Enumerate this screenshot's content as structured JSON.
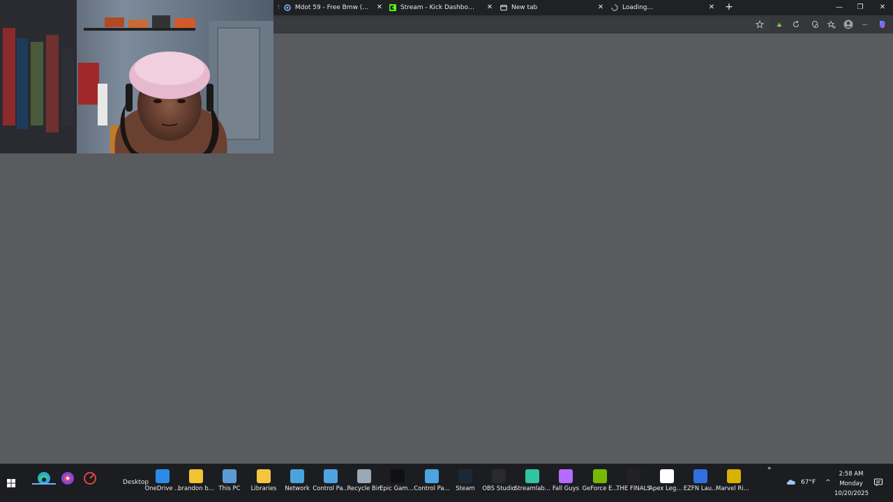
{
  "browser": {
    "tabs": [
      {
        "title": "Mdot 59 - Free Bmw (DirBy...",
        "favicon": "circle-icon"
      },
      {
        "title": "Stream - Kick Dashboard",
        "favicon": "kick-logo-icon"
      },
      {
        "title": "New tab",
        "favicon": "newtab-page-icon"
      },
      {
        "title": "Loading...",
        "favicon": "loading-spinner-icon"
      }
    ],
    "new_tab_symbol": "+",
    "close_symbol": "✕",
    "window_controls": {
      "minimize": "—",
      "restore": "❐",
      "close": "✕"
    },
    "toolbar_icons": [
      "star-icon",
      "extension-icon",
      "refresh-extension-icon",
      "browser-essentials-icon",
      "favorites-icon",
      "profile-avatar-icon",
      "more-menu-icon",
      "copilot-icon"
    ],
    "more_symbol": "···"
  },
  "taskbar": {
    "desktop_label": "Desktop",
    "pinned": [
      "edge-browser-icon",
      "app-icon-purple",
      "app-icon-red"
    ],
    "toolbar_items": [
      {
        "label": "OneDrive ...",
        "color": "#2b8be6"
      },
      {
        "label": "brandon b...",
        "color": "#f1c232"
      },
      {
        "label": "This PC",
        "color": "#5b9bd5"
      },
      {
        "label": "Libraries",
        "color": "#f4c542"
      },
      {
        "label": "Network",
        "color": "#4aa3df"
      },
      {
        "label": "Control Pa...",
        "color": "#4fa3e0"
      },
      {
        "label": "Recycle Bin",
        "color": "#9aa7b5"
      },
      {
        "label": "Epic Game...",
        "color": "#111111"
      },
      {
        "label": "Control Pa...",
        "color": "#4fa3e0"
      },
      {
        "label": "Steam",
        "color": "#1b2838"
      },
      {
        "label": "OBS Studio",
        "color": "#2a2a2a"
      },
      {
        "label": "Streamlab...",
        "color": "#31c3a2"
      },
      {
        "label": "Fall Guys",
        "color": "#b36cff"
      },
      {
        "label": "GeForce E...",
        "color": "#76b900"
      },
      {
        "label": "THE FINALS",
        "color": "#222222"
      },
      {
        "label": "Apex Lege...",
        "color": "#ffffff"
      },
      {
        "label": "EZFN Lau...",
        "color": "#2f6fe0"
      },
      {
        "label": "Marvel Riv...",
        "color": "#d8b200"
      }
    ],
    "overflow_symbol": "»",
    "weather": "67°F",
    "chevron": "^",
    "time": "2:58 AM",
    "day": "Monday",
    "date": "10/20/2025"
  }
}
